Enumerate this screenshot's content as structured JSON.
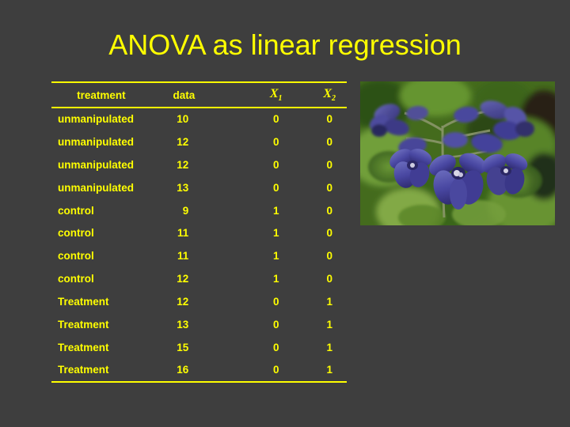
{
  "slide": {
    "title": "ANOVA as linear regression",
    "background_color": "#3e3e3e",
    "accent_color": "#ffff00"
  },
  "table": {
    "columns": [
      {
        "key": "treatment",
        "label": "treatment"
      },
      {
        "key": "data",
        "label": "data"
      },
      {
        "key": "x1",
        "label": "X",
        "subscript": "1"
      },
      {
        "key": "x2",
        "label": "X",
        "subscript": "2"
      }
    ],
    "rows": [
      {
        "treatment": "unmanipulated",
        "data": "10",
        "x1": "0",
        "x2": "0"
      },
      {
        "treatment": "unmanipulated",
        "data": "12",
        "x1": "0",
        "x2": "0"
      },
      {
        "treatment": "unmanipulated",
        "data": "12",
        "x1": "0",
        "x2": "0"
      },
      {
        "treatment": "unmanipulated",
        "data": "13",
        "x1": "0",
        "x2": "0"
      },
      {
        "treatment": "control",
        "data": "9",
        "x1": "1",
        "x2": "0"
      },
      {
        "treatment": "control",
        "data": "11",
        "x1": "1",
        "x2": "0"
      },
      {
        "treatment": "control",
        "data": "11",
        "x1": "1",
        "x2": "0"
      },
      {
        "treatment": "control",
        "data": "12",
        "x1": "1",
        "x2": "0"
      },
      {
        "treatment": "Treatment",
        "data": "12",
        "x1": "0",
        "x2": "1"
      },
      {
        "treatment": "Treatment",
        "data": "13",
        "x1": "0",
        "x2": "1"
      },
      {
        "treatment": "Treatment",
        "data": "15",
        "x1": "0",
        "x2": "1"
      },
      {
        "treatment": "Treatment",
        "data": "16",
        "x1": "0",
        "x2": "1"
      }
    ]
  },
  "photo": {
    "name": "flower-photo",
    "description": "Close-up photograph of blue-purple larkspur flowers with green foliage",
    "flower_color": "#4b4fa8",
    "foliage_color": "#4a7a28"
  }
}
